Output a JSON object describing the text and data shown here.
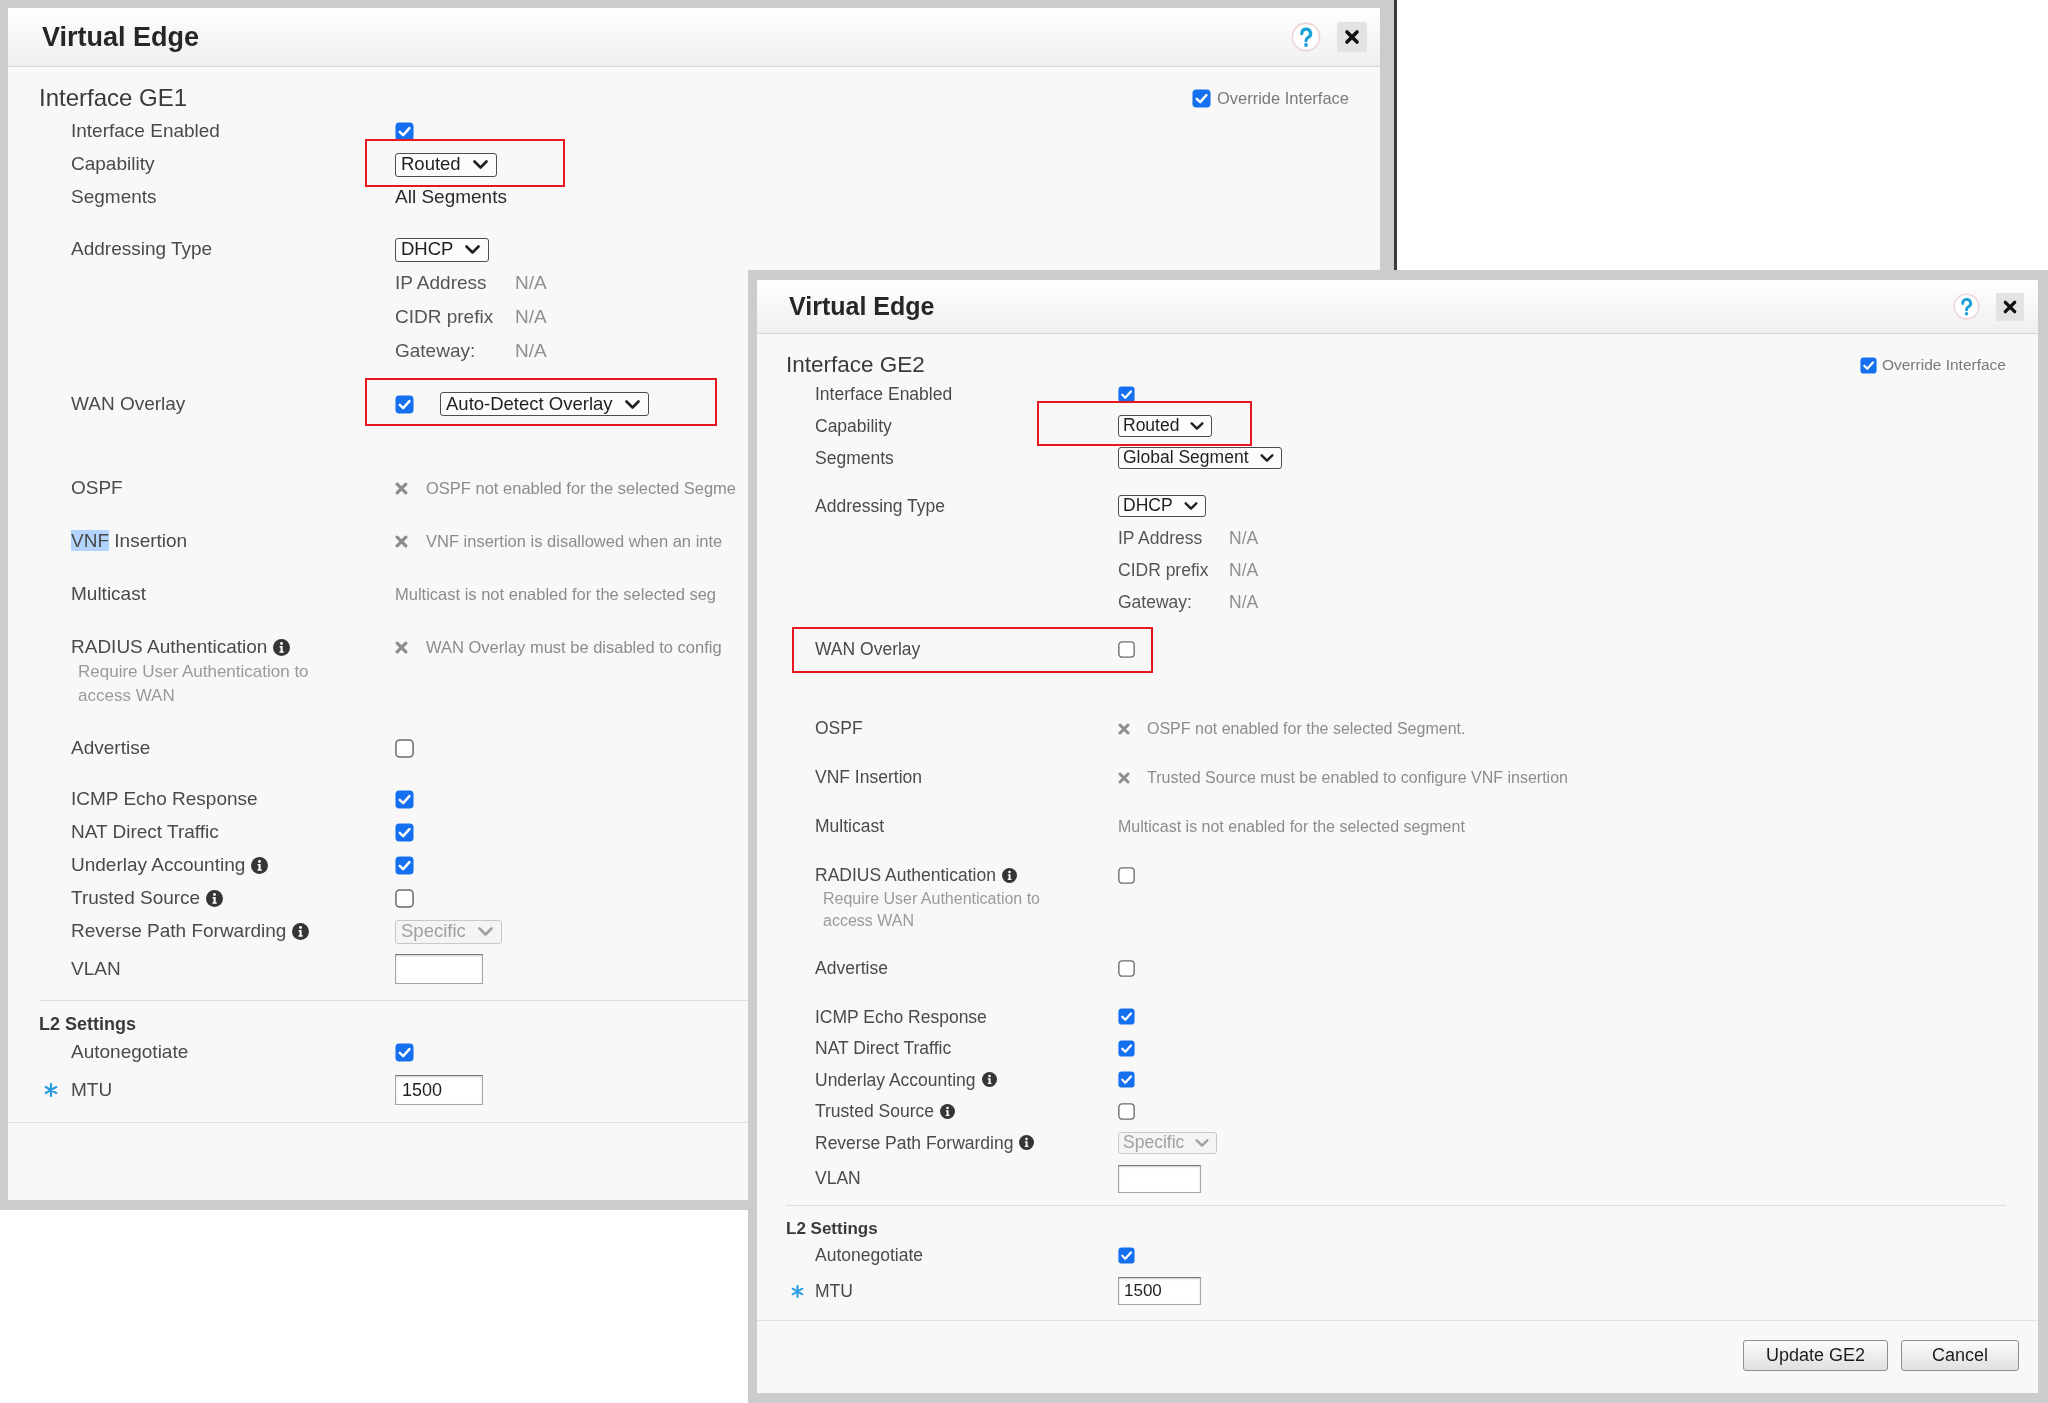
{
  "dialogs": [
    {
      "title": "Virtual Edge",
      "heading": "Interface GE1",
      "override": {
        "label": "Override Interface",
        "checked": true
      },
      "general": [
        {
          "kind": "checkbox",
          "label": "Interface Enabled",
          "checked": true
        },
        {
          "kind": "select",
          "label": "Capability",
          "value": "Routed",
          "disabled": false,
          "highlighted": true
        },
        {
          "kind": "text",
          "label": "Segments",
          "value": "All Segments"
        }
      ],
      "addressing": {
        "kind": "select",
        "label": "Addressing Type",
        "value": "DHCP",
        "disabled": false,
        "details": [
          {
            "label": "IP Address",
            "value": "N/A"
          },
          {
            "label": "CIDR prefix",
            "value": "N/A"
          },
          {
            "label": "Gateway:",
            "value": "N/A"
          }
        ]
      },
      "wan_overlay": {
        "kind": "checkbox_select",
        "label": "WAN Overlay",
        "checked": true,
        "value": "Auto-Detect Overlay",
        "disabled": false,
        "highlighted": true
      },
      "features": [
        {
          "kind": "status",
          "label": "OSPF",
          "message": "OSPF not enabled for the selected Segme"
        },
        {
          "kind": "status",
          "label_parts": [
            {
              "text": "VNF",
              "selected": true
            },
            {
              "text": "Insertion",
              "selected": false
            }
          ],
          "message": "VNF insertion is disallowed when an inte"
        },
        {
          "kind": "note",
          "label": "Multicast",
          "message": "Multicast is not enabled for the selected seg"
        },
        {
          "kind": "status",
          "label": "RADIUS Authentication",
          "info": true,
          "hint": "Require User Authentication to access WAN",
          "message": "WAN Overlay must be disabled to config"
        },
        {
          "kind": "checkbox",
          "label": "Advertise",
          "checked": false
        }
      ],
      "options": [
        {
          "kind": "checkbox",
          "label": "ICMP Echo Response",
          "checked": true
        },
        {
          "kind": "checkbox",
          "label": "NAT Direct Traffic",
          "checked": true
        },
        {
          "kind": "checkbox",
          "label": "Underlay Accounting",
          "info": true,
          "checked": true
        },
        {
          "kind": "checkbox",
          "label": "Trusted Source",
          "info": true,
          "checked": false
        },
        {
          "kind": "select",
          "label": "Reverse Path Forwarding",
          "info": true,
          "value": "Specific",
          "disabled": true
        },
        {
          "kind": "input",
          "label": "VLAN",
          "required": false
        }
      ],
      "l2_settings": {
        "heading": "L2 Settings",
        "rows": [
          {
            "kind": "checkbox",
            "label": "Autonegotiate",
            "checked": true
          },
          {
            "kind": "input",
            "label": "MTU",
            "value": "1500",
            "required": true
          }
        ]
      }
    },
    {
      "title": "Virtual Edge",
      "heading": "Interface GE2",
      "override": {
        "label": "Override Interface",
        "checked": true
      },
      "general": [
        {
          "kind": "checkbox",
          "label": "Interface Enabled",
          "checked": true
        },
        {
          "kind": "select",
          "label": "Capability",
          "value": "Routed",
          "disabled": false,
          "highlighted": true
        },
        {
          "kind": "select",
          "label": "Segments",
          "value": "Global Segment",
          "disabled": false
        }
      ],
      "addressing": {
        "kind": "select",
        "label": "Addressing Type",
        "value": "DHCP",
        "disabled": false,
        "details": [
          {
            "label": "IP Address",
            "value": "N/A"
          },
          {
            "label": "CIDR prefix",
            "value": "N/A"
          },
          {
            "label": "Gateway:",
            "value": "N/A"
          }
        ]
      },
      "wan_overlay": {
        "kind": "checkbox",
        "label": "WAN Overlay",
        "checked": false,
        "highlighted": true,
        "highlight_includes_label": true
      },
      "features": [
        {
          "kind": "status",
          "label": "OSPF",
          "message": "OSPF not enabled for the selected Segment."
        },
        {
          "kind": "status",
          "label": "VNF Insertion",
          "message": "Trusted Source must be enabled to configure VNF insertion"
        },
        {
          "kind": "note",
          "label": "Multicast",
          "message": "Multicast is not enabled for the selected segment"
        },
        {
          "kind": "checkbox",
          "label": "RADIUS Authentication",
          "info": true,
          "hint": "Require User Authentication to access WAN",
          "checked": false
        },
        {
          "kind": "checkbox",
          "label": "Advertise",
          "checked": false
        }
      ],
      "options": [
        {
          "kind": "checkbox",
          "label": "ICMP Echo Response",
          "checked": true
        },
        {
          "kind": "checkbox",
          "label": "NAT Direct Traffic",
          "checked": true
        },
        {
          "kind": "checkbox",
          "label": "Underlay Accounting",
          "info": true,
          "checked": true
        },
        {
          "kind": "checkbox",
          "label": "Trusted Source",
          "info": true,
          "checked": false
        },
        {
          "kind": "select",
          "label": "Reverse Path Forwarding",
          "info": true,
          "value": "Specific",
          "disabled": true
        },
        {
          "kind": "input",
          "label": "VLAN",
          "required": false
        }
      ],
      "l2_settings": {
        "heading": "L2 Settings",
        "rows": [
          {
            "kind": "checkbox",
            "label": "Autonegotiate",
            "checked": true
          },
          {
            "kind": "input",
            "label": "MTU",
            "value": "1500",
            "required": true
          }
        ]
      },
      "buttons": [
        "Update GE2",
        "Cancel"
      ]
    }
  ]
}
